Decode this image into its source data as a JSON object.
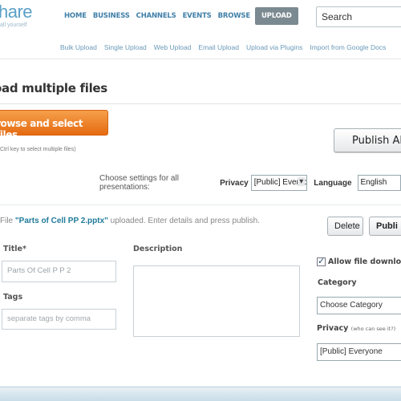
{
  "header": {
    "logo_text": "hare",
    "logo_tagline": "all yourself",
    "nav": [
      "HOME",
      "BUSINESS",
      "CHANNELS",
      "EVENTS",
      "BROWSE",
      "UPLOAD"
    ],
    "search_value": "Search"
  },
  "subnav": [
    "Bulk Upload",
    "Single Upload",
    "Web Upload",
    "Email Upload",
    "Upload via Plugins",
    "Import from Google Docs"
  ],
  "page": {
    "title": "oad multiple files",
    "browse_label": "rowse and select files...",
    "browse_hint": "Ctrl key to select multiple files)",
    "publish_all_label": "Publish All"
  },
  "settings": {
    "prefix": "Choose settings for all presentations:",
    "privacy_label": "Privacy",
    "privacy_value": "[Public] Everyo",
    "language_label": "Language",
    "language_value": "English"
  },
  "file": {
    "prefix": "File ",
    "name": "\"Parts of Cell PP 2.pptx\"",
    "status": " uploaded. Enter details and press publish.",
    "delete_label": "Delete",
    "publish_label": "Publi"
  },
  "form": {
    "title_label": "Title*",
    "title_value": "Parts Of Cell P P 2",
    "tags_label": "Tags",
    "tags_placeholder": "separate tags by comma",
    "description_label": "Description",
    "allow_download_label": "Allow file download",
    "category_label": "Category",
    "category_value": "Choose Category",
    "privacy_label": "Privacy",
    "privacy_hint": "(who can see it?)",
    "privacy_value": "[Public] Everyone"
  }
}
